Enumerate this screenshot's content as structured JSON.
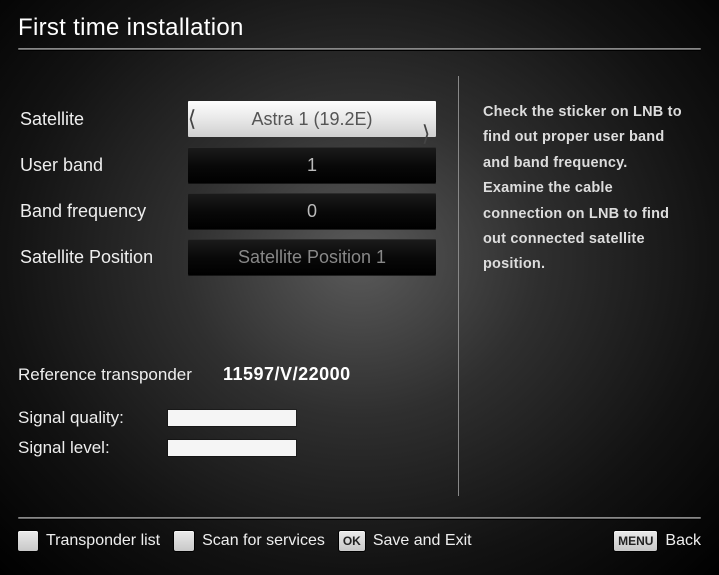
{
  "title": "First time installation",
  "settings": {
    "satellite": {
      "label": "Satellite",
      "value": "Astra 1 (19.2E)"
    },
    "user_band": {
      "label": "User band",
      "value": "1"
    },
    "band_frequency": {
      "label": "Band frequency",
      "value": "0"
    },
    "satellite_position": {
      "label": "Satellite Position",
      "value": "Satellite Position 1"
    }
  },
  "reference": {
    "label": "Reference transponder",
    "value": "11597/V/22000"
  },
  "signal": {
    "quality_label": "Signal quality:",
    "level_label": "Signal level:"
  },
  "help": "Check the sticker on LNB to find out proper user band and band frequency. Examine the cable connection on LNB to find out connected satellite position.",
  "footer": {
    "transponder_list": "Transponder list",
    "scan": "Scan for services",
    "ok_key": "OK",
    "ok_label": "Save and Exit",
    "menu_key": "MENU",
    "menu_label": "Back"
  }
}
